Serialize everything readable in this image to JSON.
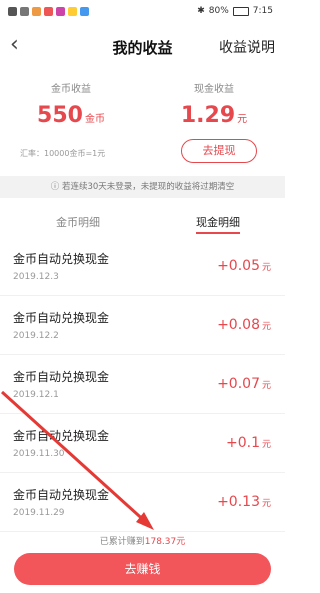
{
  "statusbar": {
    "battery": "80%",
    "time": "7:15"
  },
  "header": {
    "title": "我的收益",
    "help_label": "收益说明"
  },
  "gold": {
    "label": "金币收益",
    "amount": "550",
    "unit": "金币"
  },
  "cash": {
    "label": "现金收益",
    "amount": "1.29",
    "unit": "元"
  },
  "exchange_rate": "汇率：10000金币=1元",
  "withdraw_label": "去提现",
  "notice": "若连续30天未登录，未提现的收益将过期清空",
  "tabs": [
    {
      "label": "金币明细"
    },
    {
      "label": "现金明细"
    }
  ],
  "records": [
    {
      "title": "金币自动兑换现金",
      "date": "2019.12.3",
      "value": "+0.05",
      "unit": "元"
    },
    {
      "title": "金币自动兑换现金",
      "date": "2019.12.2",
      "value": "+0.08",
      "unit": "元"
    },
    {
      "title": "金币自动兑换现金",
      "date": "2019.12.1",
      "value": "+0.07",
      "unit": "元"
    },
    {
      "title": "金币自动兑换现金",
      "date": "2019.11.30",
      "value": "+0.1",
      "unit": "元"
    },
    {
      "title": "金币自动兑换现金",
      "date": "2019.11.29",
      "value": "+0.13",
      "unit": "元"
    }
  ],
  "total": {
    "prefix": "已累计赚到",
    "amount": "178.37元"
  },
  "earn_button": "去赚钱",
  "colors": {
    "accent": "#e5484d",
    "button": "#f2555a"
  }
}
